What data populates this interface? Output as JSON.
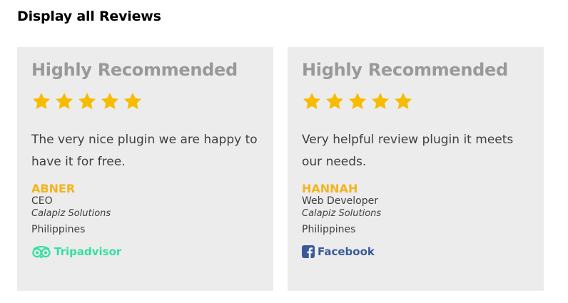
{
  "page": {
    "heading": "Display all Reviews"
  },
  "colors": {
    "star": "#f7bb00",
    "name": "#f4b41a",
    "card_background": "#ececec",
    "tripadvisor": "#34e0a1",
    "facebook": "#3b5998"
  },
  "reviews": [
    {
      "title": "Highly Recommended",
      "rating": 5,
      "rating_max": 5,
      "text": "The very nice plugin we are happy to have it for free.",
      "name": "ABNER",
      "role": "CEO",
      "company": "Calapiz Solutions",
      "country": "Philippines",
      "source": {
        "label": "Tripadvisor",
        "icon": "tripadvisor-icon"
      }
    },
    {
      "title": "Highly Recommended",
      "rating": 5,
      "rating_max": 5,
      "text": "Very helpful review plugin it meets our needs.",
      "name": "HANNAH",
      "role": "Web Developer",
      "company": "Calapiz Solutions",
      "country": "Philippines",
      "source": {
        "label": "Facebook",
        "icon": "facebook-icon"
      }
    }
  ]
}
